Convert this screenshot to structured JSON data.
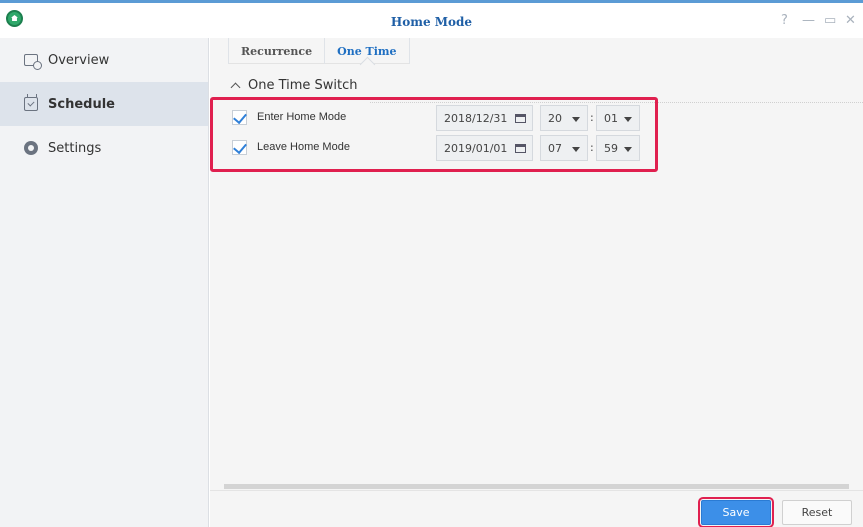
{
  "window": {
    "title": "Home Mode",
    "controls": {
      "help": "?",
      "minimize": "—",
      "maximize": "▭",
      "close": "✕"
    }
  },
  "sidebar": {
    "items": [
      {
        "label": "Overview",
        "icon": "overview-icon",
        "active": false
      },
      {
        "label": "Schedule",
        "icon": "calendar-icon",
        "active": true
      },
      {
        "label": "Settings",
        "icon": "gear-icon",
        "active": false
      }
    ]
  },
  "tabs": [
    {
      "label": "Recurrence",
      "active": false
    },
    {
      "label": "One Time",
      "active": true
    }
  ],
  "section": {
    "title": "One Time Switch"
  },
  "switches": [
    {
      "label": "Enter Home Mode",
      "checked": true,
      "date": "2018/12/31",
      "hour": "20",
      "minute": "01"
    },
    {
      "label": "Leave Home Mode",
      "checked": true,
      "date": "2019/01/01",
      "hour": "07",
      "minute": "59"
    }
  ],
  "time_separator": ":",
  "footer": {
    "save_label": "Save",
    "reset_label": "Reset"
  },
  "colors": {
    "accent": "#3c8fe8",
    "highlight": "#e0204f",
    "title": "#1f5fa6"
  }
}
